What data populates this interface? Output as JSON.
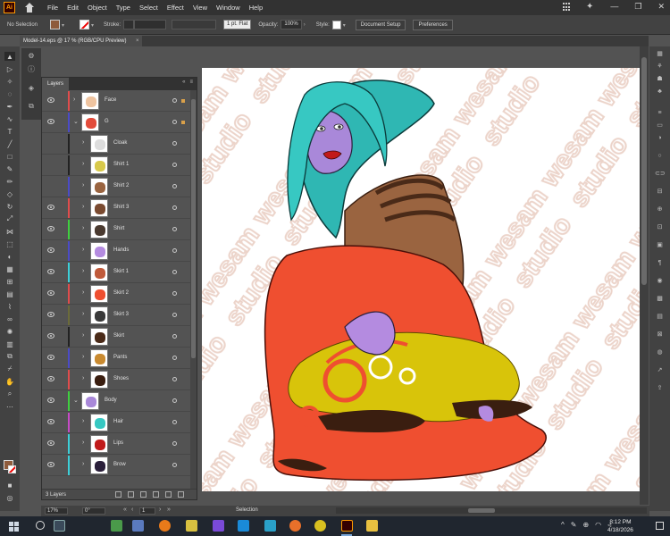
{
  "app": {
    "logo_text": "Ai",
    "menus": [
      "File",
      "Edit",
      "Object",
      "Type",
      "Select",
      "Effect",
      "View",
      "Window",
      "Help"
    ],
    "window_controls": [
      "—",
      "❐",
      "✕"
    ]
  },
  "control_bar": {
    "selection": "No Selection",
    "fill_color": "#8e5b3c",
    "stroke_label": "Stroke:",
    "brush_value": "1 pt. Flat",
    "opacity_label": "Opacity:",
    "opacity_value": "100%",
    "style_label": "Style:",
    "document_setup": "Document Setup",
    "preferences": "Preferences"
  },
  "document": {
    "tab_title": "Model-14.eps @ 17 % (RGB/CPU Preview)",
    "close": "×"
  },
  "layers_panel": {
    "title": "Layers",
    "collapse": "«",
    "menu": "≡",
    "rows": [
      {
        "name": "Face",
        "color": "#e04c4c",
        "indent": 0,
        "has_eye": true,
        "chevron": "›",
        "expanded": false
      },
      {
        "name": "G",
        "color": "#4b4bc6",
        "indent": 0,
        "has_eye": true,
        "chevron": "⌄",
        "expanded": true
      },
      {
        "name": "Cloak",
        "color": "#222222",
        "indent": 1,
        "has_eye": false,
        "chevron": "›",
        "expanded": false
      },
      {
        "name": "Shirt 1",
        "color": "#222222",
        "indent": 1,
        "has_eye": false,
        "chevron": "›",
        "expanded": false
      },
      {
        "name": "Shirt 2",
        "color": "#4b4bc6",
        "indent": 1,
        "has_eye": false,
        "chevron": "›",
        "expanded": false
      },
      {
        "name": "Shirt 3",
        "color": "#e04c4c",
        "indent": 1,
        "has_eye": true,
        "chevron": "›",
        "expanded": false
      },
      {
        "name": "Shirt",
        "color": "#3fcf3f",
        "indent": 1,
        "has_eye": true,
        "chevron": "›",
        "expanded": false
      },
      {
        "name": "Hands",
        "color": "#4b4bc6",
        "indent": 1,
        "has_eye": true,
        "chevron": "›",
        "expanded": false
      },
      {
        "name": "Skirt 1",
        "color": "#3ccfd8",
        "indent": 1,
        "has_eye": true,
        "chevron": "›",
        "expanded": false
      },
      {
        "name": "Skirt 2",
        "color": "#e04c4c",
        "indent": 1,
        "has_eye": true,
        "chevron": "›",
        "expanded": false
      },
      {
        "name": "Skirt 3",
        "color": "#6b6b3a",
        "indent": 1,
        "has_eye": true,
        "chevron": "›",
        "expanded": false
      },
      {
        "name": "Skirt",
        "color": "#222222",
        "indent": 1,
        "has_eye": true,
        "chevron": "›",
        "expanded": false
      },
      {
        "name": "Pants",
        "color": "#4b4bc6",
        "indent": 1,
        "has_eye": true,
        "chevron": "›",
        "expanded": false
      },
      {
        "name": "Shoes",
        "color": "#e04c4c",
        "indent": 1,
        "has_eye": true,
        "chevron": "›",
        "expanded": false
      },
      {
        "name": "Body",
        "color": "#3fcf3f",
        "indent": 0,
        "has_eye": true,
        "chevron": "⌄",
        "expanded": true
      },
      {
        "name": "Hair",
        "color": "#c64bc6",
        "indent": 1,
        "has_eye": true,
        "chevron": "›",
        "expanded": false
      },
      {
        "name": "Lips",
        "color": "#3ccfd8",
        "indent": 1,
        "has_eye": true,
        "chevron": "›",
        "expanded": false
      },
      {
        "name": "Brow",
        "color": "#3ccfd8",
        "indent": 1,
        "has_eye": true,
        "chevron": "›",
        "expanded": false
      }
    ],
    "footer_count": "3 Layers"
  },
  "status_bar": {
    "zoom": "17%",
    "rotation": "0°",
    "nav_first": "«",
    "nav_prev": "‹",
    "artboard": "1",
    "nav_next": "›",
    "nav_last": "»",
    "tool": "Selection"
  },
  "watermark": "wesam studio",
  "taskbar": {
    "time": "8:12 PM",
    "date": "4/18/2026",
    "tray_up": "^",
    "tray_wifi": "◠",
    "tray_volume": "◃",
    "tray_lang": "⊕"
  }
}
